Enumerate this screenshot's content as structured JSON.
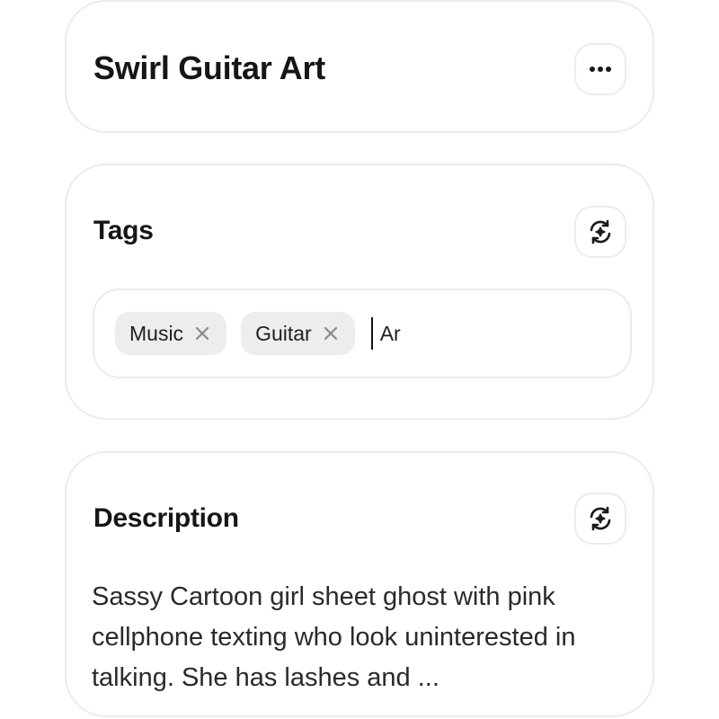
{
  "title_card": {
    "title": "Swirl Guitar Art",
    "menu_icon": "more-horizontal-icon"
  },
  "tags_card": {
    "heading": "Tags",
    "regenerate_icon": "sparkle-refresh-icon",
    "tags": [
      {
        "label": "Music",
        "remove_icon": "close-icon"
      },
      {
        "label": "Guitar",
        "remove_icon": "close-icon"
      }
    ],
    "input_value": "Ar"
  },
  "description_card": {
    "heading": "Description",
    "regenerate_icon": "sparkle-refresh-icon",
    "text": "Sassy Cartoon girl sheet ghost with pink cellphone texting who look uninterested in talking. She has lashes and ..."
  }
}
